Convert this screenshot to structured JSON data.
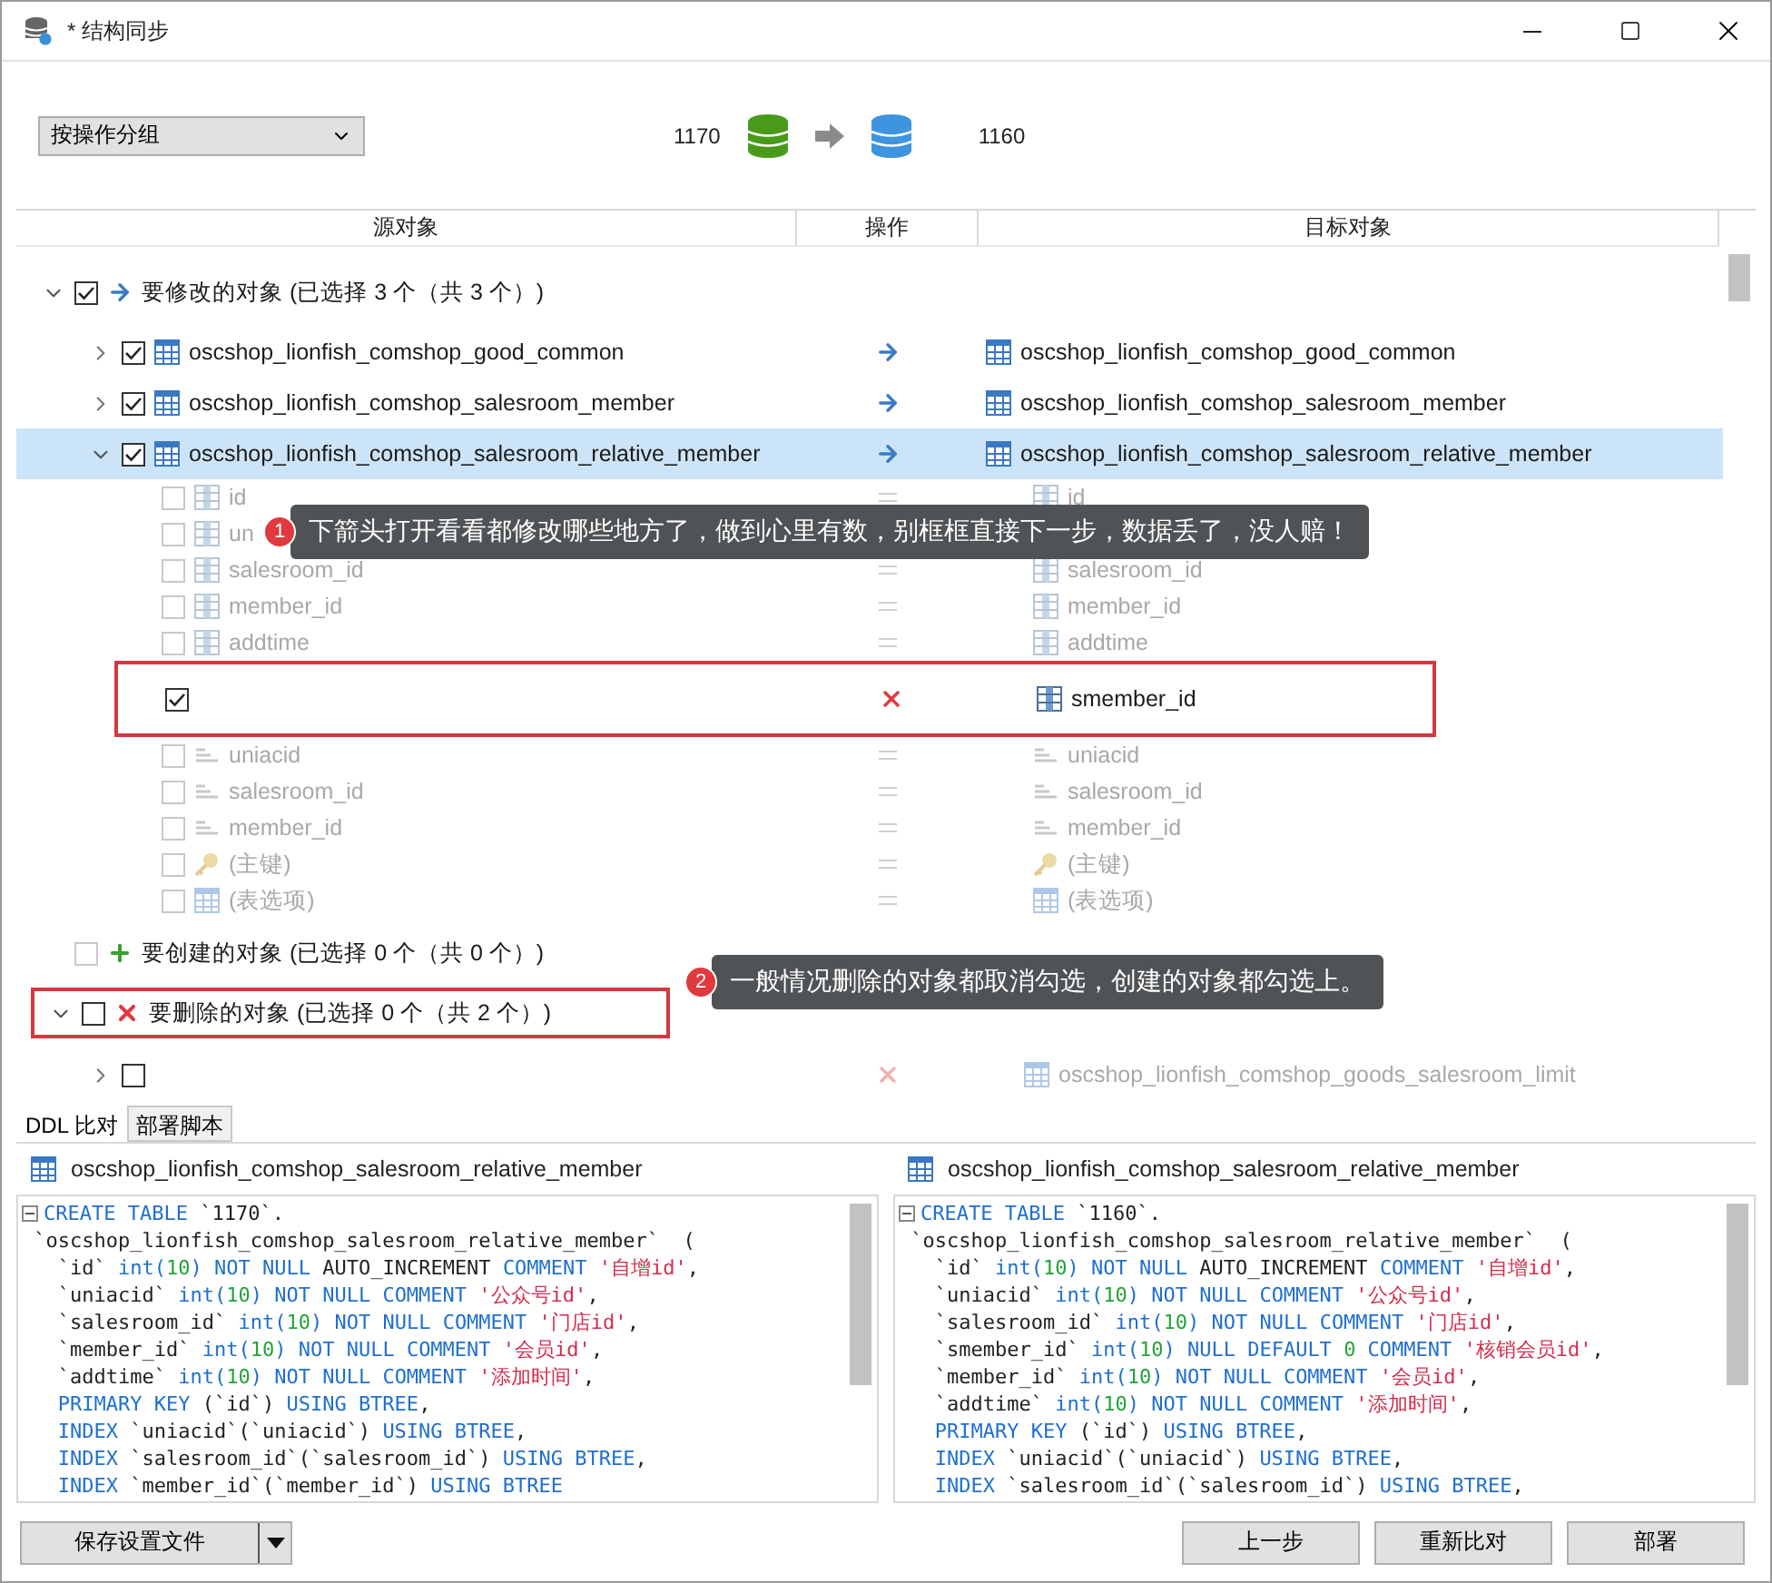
{
  "window": {
    "title": "* 结构同步"
  },
  "toolbar": {
    "group_select": "按操作分组",
    "source": "1170",
    "target": "1160"
  },
  "columns": [
    "源对象",
    "操作",
    "目标对象"
  ],
  "groups": [
    {
      "kind": "modify",
      "label": "要修改的对象 (已选择 3 个（共 3 个）)",
      "checked": true,
      "expanded": true,
      "highlighted": false,
      "tables": [
        {
          "source": "oscshop_lionfish_comshop_good_common",
          "target": "oscshop_lionfish_comshop_good_common",
          "removed": false,
          "checked": true,
          "expanded": false,
          "selected": false
        },
        {
          "source": "oscshop_lionfish_comshop_salesroom_member",
          "target": "oscshop_lionfish_comshop_salesroom_member",
          "removed": false,
          "checked": true,
          "expanded": false,
          "selected": false
        },
        {
          "source": "oscshop_lionfish_comshop_salesroom_relative_member",
          "target": "oscshop_lionfish_comshop_salesroom_relative_member",
          "removed": false,
          "checked": true,
          "expanded": true,
          "selected": true,
          "fields": [
            {
              "kind": "column",
              "source": "id",
              "target": "id",
              "removed": false,
              "checked": false,
              "highlighted": false
            },
            {
              "kind": "column",
              "source": "un",
              "checked": false,
              "highlighted": false,
              "note": {
                "number": "1",
                "text": "下箭头打开看看都修改哪些地方了，做到心里有数，别框框直接下一步，数据丢了，没人赔！"
              }
            },
            {
              "kind": "column",
              "source": "salesroom_id",
              "target": "salesroom_id",
              "removed": false,
              "checked": false,
              "highlighted": false
            },
            {
              "kind": "column",
              "source": "member_id",
              "target": "member_id",
              "removed": false,
              "checked": false,
              "highlighted": false
            },
            {
              "kind": "column",
              "source": "addtime",
              "target": "addtime",
              "removed": false,
              "checked": false,
              "highlighted": false
            },
            {
              "kind": "column",
              "target": "smember_id",
              "removed": true,
              "checked": true,
              "highlighted": true
            },
            {
              "kind": "index",
              "source": "uniacid",
              "target": "uniacid",
              "removed": false,
              "checked": false,
              "highlighted": false
            },
            {
              "kind": "index",
              "source": "salesroom_id",
              "target": "salesroom_id",
              "removed": false,
              "checked": false,
              "highlighted": false
            },
            {
              "kind": "index",
              "source": "member_id",
              "target": "member_id",
              "removed": false,
              "checked": false,
              "highlighted": false
            },
            {
              "kind": "key",
              "source": "(主键)",
              "target": "(主键)",
              "removed": false,
              "checked": false,
              "highlighted": false
            },
            {
              "kind": "options",
              "source": "(表选项)",
              "target": "(表选项)",
              "removed": false,
              "checked": false,
              "highlighted": false
            }
          ]
        }
      ]
    },
    {
      "kind": "create",
      "label": "要创建的对象 (已选择 0 个（共 0 个）)",
      "checked": false,
      "highlighted": false
    },
    {
      "kind": "delete",
      "label": "要删除的对象 (已选择 0 个（共 2 个）)",
      "checked": false,
      "expanded": true,
      "highlighted": true,
      "note": {
        "number": "2",
        "text": "一般情况删除的对象都取消勾选，创建的对象都勾选上。"
      },
      "tables": [
        {
          "target": "oscshop_lionfish_comshop_goods_salesroom_limit",
          "removed": true,
          "checked": false,
          "expanded": false,
          "selected": false
        }
      ]
    }
  ],
  "tabs": [
    {
      "label": "DDL 比对",
      "selected": true
    },
    {
      "label": "部署脚本",
      "selected": false
    }
  ],
  "panes": [
    {
      "title": "oscshop_lionfish_comshop_salesroom_relative_member",
      "code": [
        [
          {
            "kind": "kw",
            "text": "CREATE TABLE"
          },
          {
            "kind": "plain",
            "text": " `1170`."
          }
        ],
        [
          {
            "kind": "plain",
            "text": " `oscshop_lionfish_comshop_salesroom_relative_member`  ("
          }
        ],
        [
          {
            "kind": "plain",
            "text": "   `id` "
          },
          {
            "kind": "kw",
            "text": "int("
          },
          {
            "kind": "num",
            "text": "10"
          },
          {
            "kind": "kw",
            "text": ") NOT NULL"
          },
          {
            "kind": "plain",
            "text": " AUTO_INCREMENT "
          },
          {
            "kind": "kw",
            "text": "COMMENT"
          },
          {
            "kind": "str",
            "text": " '自增id'"
          },
          {
            "kind": "plain",
            "text": ","
          }
        ],
        [
          {
            "kind": "plain",
            "text": "   `uniacid` "
          },
          {
            "kind": "kw",
            "text": "int("
          },
          {
            "kind": "num",
            "text": "10"
          },
          {
            "kind": "kw",
            "text": ") NOT NULL COMMENT"
          },
          {
            "kind": "str",
            "text": " '公众号id'"
          },
          {
            "kind": "plain",
            "text": ","
          }
        ],
        [
          {
            "kind": "plain",
            "text": "   `salesroom_id` "
          },
          {
            "kind": "kw",
            "text": "int("
          },
          {
            "kind": "num",
            "text": "10"
          },
          {
            "kind": "kw",
            "text": ") NOT NULL COMMENT"
          },
          {
            "kind": "str",
            "text": " '门店id'"
          },
          {
            "kind": "plain",
            "text": ","
          }
        ],
        [
          {
            "kind": "plain",
            "text": "   `member_id` "
          },
          {
            "kind": "kw",
            "text": "int("
          },
          {
            "kind": "num",
            "text": "10"
          },
          {
            "kind": "kw",
            "text": ") NOT NULL COMMENT"
          },
          {
            "kind": "str",
            "text": " '会员id'"
          },
          {
            "kind": "plain",
            "text": ","
          }
        ],
        [
          {
            "kind": "plain",
            "text": "   `addtime` "
          },
          {
            "kind": "kw",
            "text": "int("
          },
          {
            "kind": "num",
            "text": "10"
          },
          {
            "kind": "kw",
            "text": ") NOT NULL COMMENT"
          },
          {
            "kind": "str",
            "text": " '添加时间'"
          },
          {
            "kind": "plain",
            "text": ","
          }
        ],
        [
          {
            "kind": "kw",
            "text": "   PRIMARY KEY"
          },
          {
            "kind": "plain",
            "text": " (`id`) "
          },
          {
            "kind": "kw",
            "text": "USING BTREE"
          },
          {
            "kind": "plain",
            "text": ","
          }
        ],
        [
          {
            "kind": "kw",
            "text": "   INDEX"
          },
          {
            "kind": "plain",
            "text": " `uniacid`(`uniacid`) "
          },
          {
            "kind": "kw",
            "text": "USING BTREE"
          },
          {
            "kind": "plain",
            "text": ","
          }
        ],
        [
          {
            "kind": "kw",
            "text": "   INDEX"
          },
          {
            "kind": "plain",
            "text": " `salesroom_id`(`salesroom_id`) "
          },
          {
            "kind": "kw",
            "text": "USING BTREE"
          },
          {
            "kind": "plain",
            "text": ","
          }
        ],
        [
          {
            "kind": "kw",
            "text": "   INDEX"
          },
          {
            "kind": "plain",
            "text": " `member_id`(`member_id`) "
          },
          {
            "kind": "kw",
            "text": "USING BTREE"
          }
        ]
      ]
    },
    {
      "title": "oscshop_lionfish_comshop_salesroom_relative_member",
      "code": [
        [
          {
            "kind": "kw",
            "text": "CREATE TABLE"
          },
          {
            "kind": "plain",
            "text": " `1160`."
          }
        ],
        [
          {
            "kind": "plain",
            "text": " `oscshop_lionfish_comshop_salesroom_relative_member`  ("
          }
        ],
        [
          {
            "kind": "plain",
            "text": "   `id` "
          },
          {
            "kind": "kw",
            "text": "int("
          },
          {
            "kind": "num",
            "text": "10"
          },
          {
            "kind": "kw",
            "text": ") NOT NULL"
          },
          {
            "kind": "plain",
            "text": " AUTO_INCREMENT "
          },
          {
            "kind": "kw",
            "text": "COMMENT"
          },
          {
            "kind": "str",
            "text": " '自增id'"
          },
          {
            "kind": "plain",
            "text": ","
          }
        ],
        [
          {
            "kind": "plain",
            "text": "   `uniacid` "
          },
          {
            "kind": "kw",
            "text": "int("
          },
          {
            "kind": "num",
            "text": "10"
          },
          {
            "kind": "kw",
            "text": ") NOT NULL COMMENT"
          },
          {
            "kind": "str",
            "text": " '公众号id'"
          },
          {
            "kind": "plain",
            "text": ","
          }
        ],
        [
          {
            "kind": "plain",
            "text": "   `salesroom_id` "
          },
          {
            "kind": "kw",
            "text": "int("
          },
          {
            "kind": "num",
            "text": "10"
          },
          {
            "kind": "kw",
            "text": ") NOT NULL COMMENT"
          },
          {
            "kind": "str",
            "text": " '门店id'"
          },
          {
            "kind": "plain",
            "text": ","
          }
        ],
        [
          {
            "kind": "plain",
            "text": "   `smember_id` "
          },
          {
            "kind": "kw",
            "text": "int("
          },
          {
            "kind": "num",
            "text": "10"
          },
          {
            "kind": "kw",
            "text": ") NULL DEFAULT "
          },
          {
            "kind": "num",
            "text": "0"
          },
          {
            "kind": "kw",
            "text": " COMMENT"
          },
          {
            "kind": "str",
            "text": " '核销会员id'"
          },
          {
            "kind": "plain",
            "text": ","
          }
        ],
        [
          {
            "kind": "plain",
            "text": "   `member_id` "
          },
          {
            "kind": "kw",
            "text": "int("
          },
          {
            "kind": "num",
            "text": "10"
          },
          {
            "kind": "kw",
            "text": ") NOT NULL COMMENT"
          },
          {
            "kind": "str",
            "text": " '会员id'"
          },
          {
            "kind": "plain",
            "text": ","
          }
        ],
        [
          {
            "kind": "plain",
            "text": "   `addtime` "
          },
          {
            "kind": "kw",
            "text": "int("
          },
          {
            "kind": "num",
            "text": "10"
          },
          {
            "kind": "kw",
            "text": ") NOT NULL COMMENT"
          },
          {
            "kind": "str",
            "text": " '添加时间'"
          },
          {
            "kind": "plain",
            "text": ","
          }
        ],
        [
          {
            "kind": "kw",
            "text": "   PRIMARY KEY"
          },
          {
            "kind": "plain",
            "text": " (`id`) "
          },
          {
            "kind": "kw",
            "text": "USING BTREE"
          },
          {
            "kind": "plain",
            "text": ","
          }
        ],
        [
          {
            "kind": "kw",
            "text": "   INDEX"
          },
          {
            "kind": "plain",
            "text": " `uniacid`(`uniacid`) "
          },
          {
            "kind": "kw",
            "text": "USING BTREE"
          },
          {
            "kind": "plain",
            "text": ","
          }
        ],
        [
          {
            "kind": "kw",
            "text": "   INDEX"
          },
          {
            "kind": "plain",
            "text": " `salesroom_id`(`salesroom_id`) "
          },
          {
            "kind": "kw",
            "text": "USING BTREE"
          },
          {
            "kind": "plain",
            "text": ","
          }
        ]
      ]
    }
  ],
  "buttons": {
    "save": "保存设置文件",
    "actions": [
      "上一步",
      "重新比对",
      "部署"
    ]
  }
}
